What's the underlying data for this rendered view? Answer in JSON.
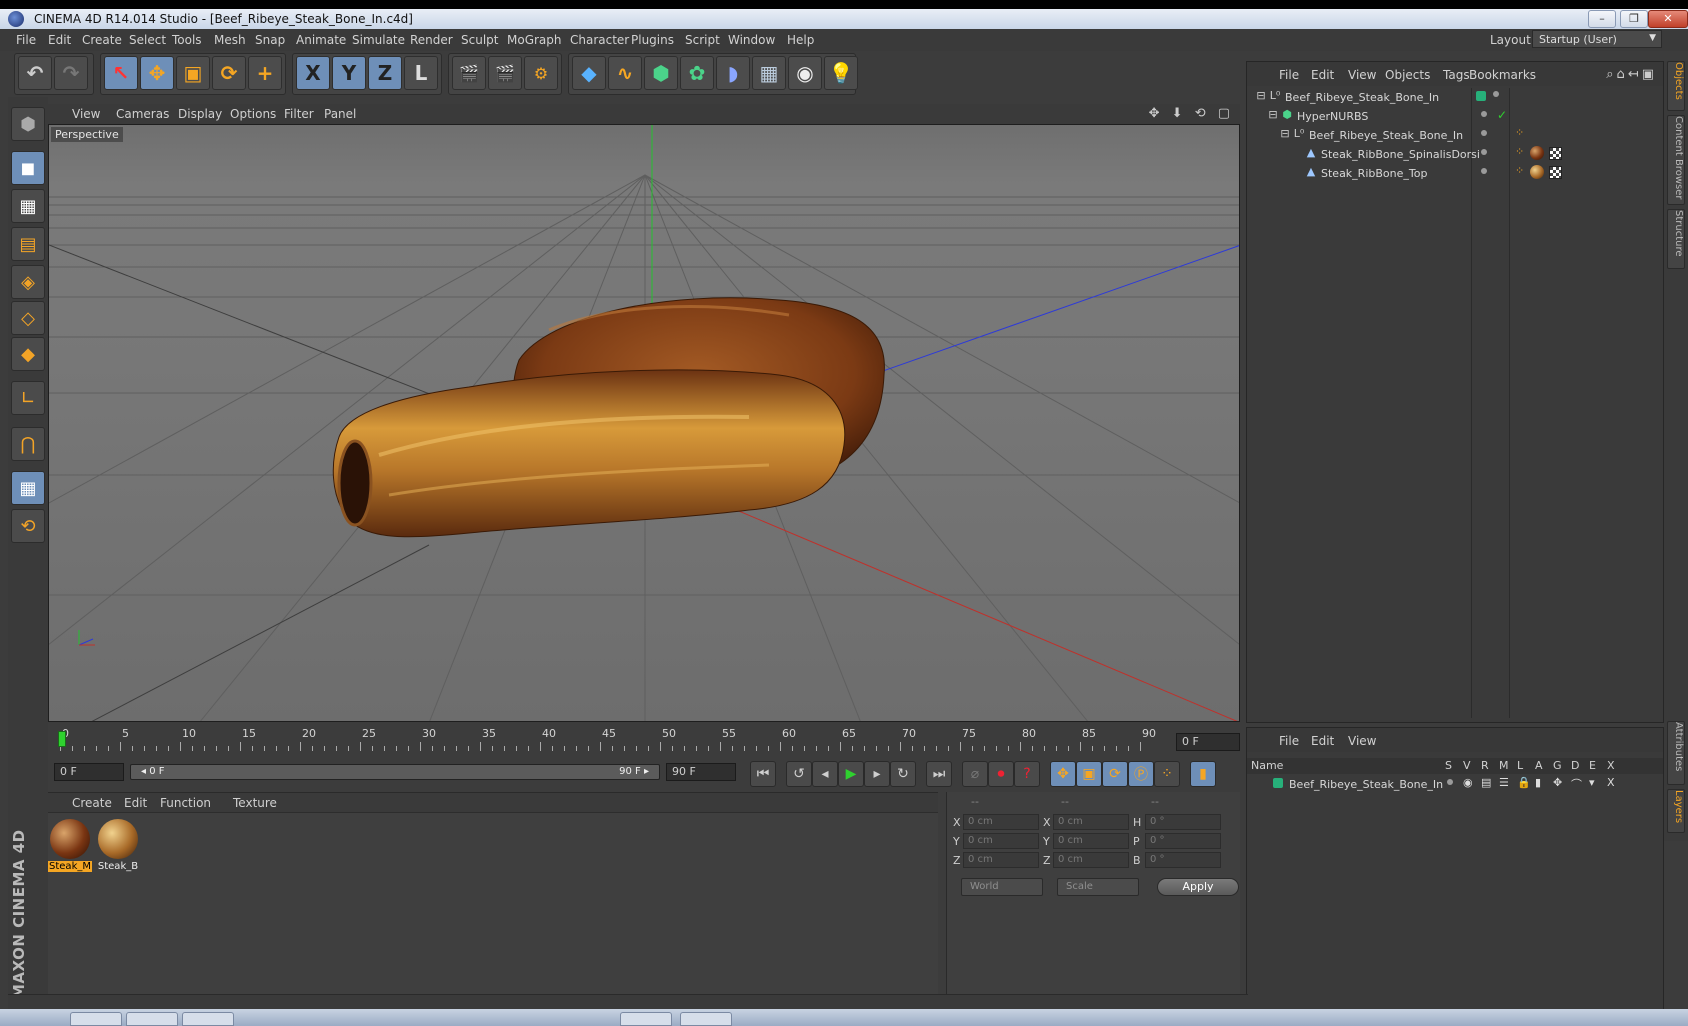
{
  "window": {
    "title": "CINEMA 4D R14.014 Studio - [Beef_Ribeye_Steak_Bone_In.c4d]",
    "buttons": [
      "–",
      "❐",
      "✕"
    ]
  },
  "menubar": {
    "items": [
      "File",
      "Edit",
      "Create",
      "Select",
      "Tools",
      "Mesh",
      "Snap",
      "Animate",
      "Simulate",
      "Render",
      "Sculpt",
      "MoGraph",
      "Character",
      "Plugins",
      "Script",
      "Window",
      "Help"
    ],
    "layout_label": "Layout:",
    "layout_value": "Startup (User)"
  },
  "toolbar": {
    "undo": "↶",
    "redo": "↷",
    "live_select": "↖",
    "move": "✥",
    "scale": "▣",
    "rotate": "⟳",
    "recent": "+",
    "x": "X",
    "y": "Y",
    "z": "Z",
    "coord": "L"
  },
  "viewport": {
    "menu": [
      "View",
      "Cameras",
      "Display",
      "Options",
      "Filter",
      "Panel"
    ],
    "label": "Perspective",
    "nav_icons": "✥ ⬇ ⟲ ▢"
  },
  "timeline": {
    "ticks": [
      "0",
      "5",
      "10",
      "15",
      "20",
      "25",
      "30",
      "35",
      "40",
      "45",
      "50",
      "55",
      "60",
      "65",
      "70",
      "75",
      "80",
      "85",
      "90"
    ],
    "frame_indicator": "0 F",
    "current_frame": "0 F",
    "slider_start": "◂ 0 F",
    "slider_end": "90 F ▸",
    "end_frame": "90 F"
  },
  "material_manager": {
    "menu": [
      "Create",
      "Edit",
      "Function",
      "Texture"
    ],
    "materials": [
      {
        "name": "Steak_M",
        "selected": true
      },
      {
        "name": "Steak_B",
        "selected": false
      }
    ]
  },
  "coordinates": {
    "headers": [
      "--",
      "--",
      "--"
    ],
    "rows": [
      {
        "l1": "X",
        "v1": "0 cm",
        "l2": "X",
        "v2": "0 cm",
        "l3": "H",
        "v3": "0 °"
      },
      {
        "l1": "Y",
        "v1": "0 cm",
        "l2": "Y",
        "v2": "0 cm",
        "l3": "P",
        "v3": "0 °"
      },
      {
        "l1": "Z",
        "v1": "0 cm",
        "l2": "Z",
        "v2": "0 cm",
        "l3": "B",
        "v3": "0 °"
      }
    ],
    "mode": "World",
    "transform": "Scale",
    "apply": "Apply"
  },
  "object_manager": {
    "menu": [
      "File",
      "Edit",
      "View",
      "Objects",
      "Tags",
      "Bookmarks"
    ],
    "objects": [
      {
        "name": "Beef_Ribeye_Steak_Bone_In",
        "icon": "null-icon"
      },
      {
        "name": "HyperNURBS",
        "icon": "hypernurbs-icon"
      },
      {
        "name": "Beef_Ribeye_Steak_Bone_In",
        "icon": "null-icon"
      },
      {
        "name": "Steak_RibBone_SpinalisDorsi",
        "icon": "polygon-icon"
      },
      {
        "name": "Steak_RibBone_Top",
        "icon": "polygon-icon"
      }
    ]
  },
  "layer_manager": {
    "menu": [
      "File",
      "Edit",
      "View"
    ],
    "columns": [
      "Name",
      "S",
      "V",
      "R",
      "M",
      "L",
      "A",
      "G",
      "D",
      "E",
      "X"
    ],
    "layers": [
      {
        "name": "Beef_Ribeye_Steak_Bone_In"
      }
    ]
  },
  "side_tabs": [
    "Objects",
    "Content Browser",
    "Structure",
    "Attributes",
    "Layers"
  ],
  "branding": "MAXON CINEMA 4D"
}
